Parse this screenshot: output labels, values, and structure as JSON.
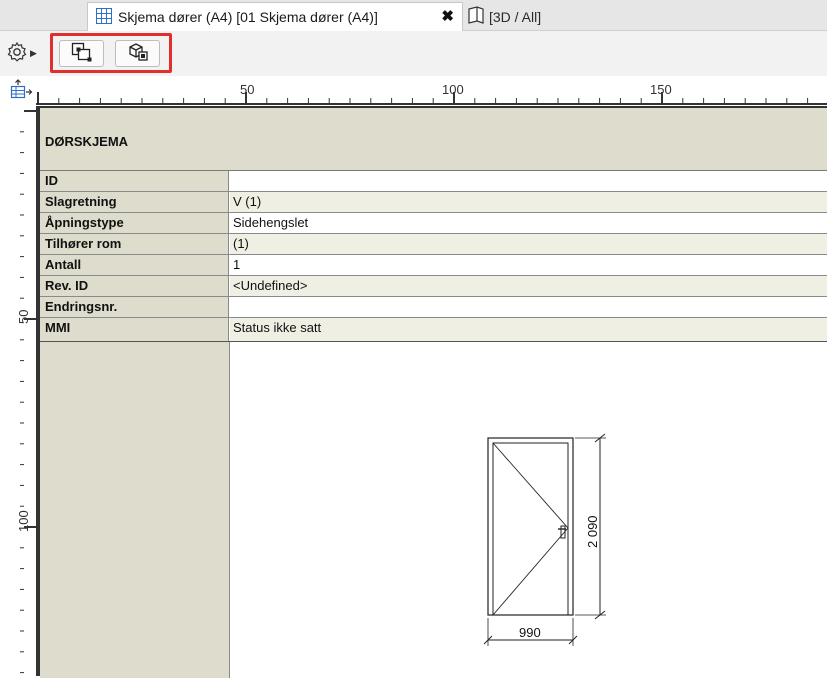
{
  "tabs": {
    "active_label": "Skjema dører (A4) [01 Skjema dører (A4)]",
    "close_symbol": "✖",
    "inactive_label": "[3D / All]"
  },
  "ruler": {
    "h_labels": [
      "50",
      "100",
      "150"
    ],
    "v_labels": [
      "50",
      "100"
    ]
  },
  "schedule": {
    "title": "DØRSKJEMA",
    "rows": [
      {
        "key": "ID",
        "value": ""
      },
      {
        "key": "Slagretning",
        "value": "V (1)"
      },
      {
        "key": "Åpningstype",
        "value": "Sidehengslet"
      },
      {
        "key": "Tilhører rom",
        "value": " (1)"
      },
      {
        "key": "Antall",
        "value": "1"
      },
      {
        "key": "Rev. ID",
        "value": "<Undefined>"
      },
      {
        "key": "Endringsnr.",
        "value": ""
      },
      {
        "key": "MMI",
        "value": "Status ikke satt"
      }
    ]
  },
  "door_drawing": {
    "width_label": "990",
    "height_label": "2 090"
  },
  "colors": {
    "header_fill": "#dddccd",
    "highlight": "#e0302e",
    "tab_icon": "#2f6fc7"
  },
  "icons": [
    "schedule-grid-icon",
    "3d-view-icon",
    "gear-icon",
    "modify-element-icon",
    "3d-element-icon",
    "table-insert-icon"
  ]
}
